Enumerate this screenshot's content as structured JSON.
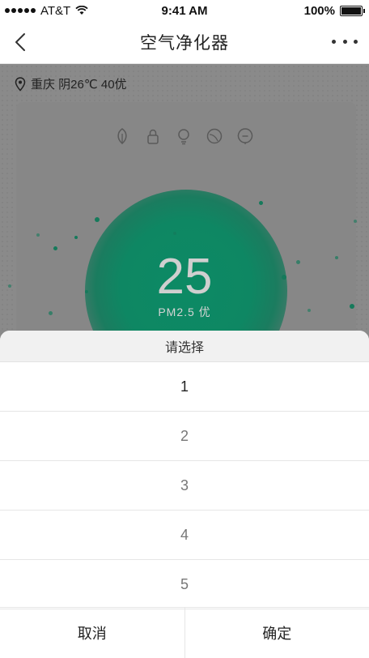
{
  "status_bar": {
    "carrier": "AT&T",
    "time": "9:41 AM",
    "battery": "100%"
  },
  "nav": {
    "title": "空气净化器"
  },
  "location": {
    "text": "重庆 阴26℃   40优"
  },
  "air": {
    "value": "25",
    "label": "PM2.5  优"
  },
  "picker": {
    "title": "请选择",
    "options": [
      "1",
      "2",
      "3",
      "4",
      "5"
    ],
    "selected": "1",
    "cancel_label": "取消",
    "confirm_label": "确定"
  },
  "icons": [
    "back-icon",
    "more-icon",
    "location-pin-icon",
    "leaf-mode-icon",
    "lock-icon",
    "light-icon",
    "sleep-mode-icon",
    "minus-mode-icon",
    "wifi-icon",
    "battery-icon"
  ],
  "colors": {
    "accent_green": "#0c8a64",
    "overlay": "#7b7b7b",
    "sheet_bg": "#ffffff",
    "sheet_header_bg": "#f1f1f1"
  }
}
